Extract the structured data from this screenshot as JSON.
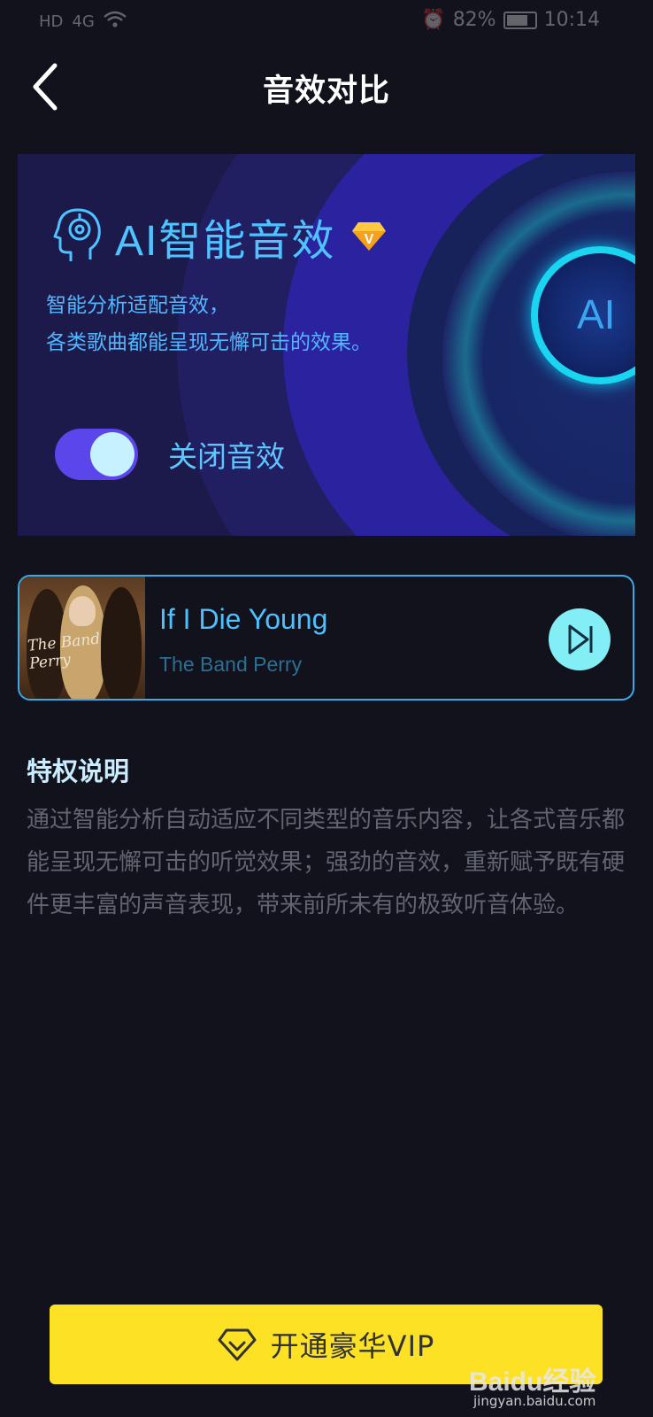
{
  "status_bar": {
    "left_items": [
      "HD",
      "4G",
      "WiFi"
    ],
    "battery": "82%",
    "battery_level": 0.82,
    "time": "10:14"
  },
  "header": {
    "title": "音效对比",
    "back_icon": "chevron-left-icon"
  },
  "banner": {
    "title": "AI智能音效",
    "badge_letter": "V",
    "desc_line1": "智能分析适配音效，",
    "desc_line2": "各类歌曲都能呈现无懈可击的效果。",
    "toggle_label": "关闭音效",
    "toggle_on": true,
    "ai_circle_text": "AI",
    "colors": {
      "accent": "#4ec3ff",
      "toggle_track": "#5a46ea",
      "toggle_knob": "#c6f2ff",
      "ring": "#19d5f0"
    }
  },
  "song": {
    "title": "If I Die Young",
    "artist": "The Band Perry",
    "cover_text": "The Band Perry",
    "play_icon": "skip-next-icon"
  },
  "privilege": {
    "title": "特权说明",
    "body": "通过智能分析自动适应不同类型的音乐内容，让各式音乐都能呈现无懈可击的听觉效果；强劲的音效，重新赋予既有硬件更丰富的声音表现，带来前所未有的极致听音体验。"
  },
  "vip_button": {
    "label": "开通豪华VIP",
    "icon": "diamond-icon",
    "color": "#fde125"
  },
  "watermark": {
    "brand": "Baidu经验",
    "sub": "jingyan.baidu.com"
  }
}
